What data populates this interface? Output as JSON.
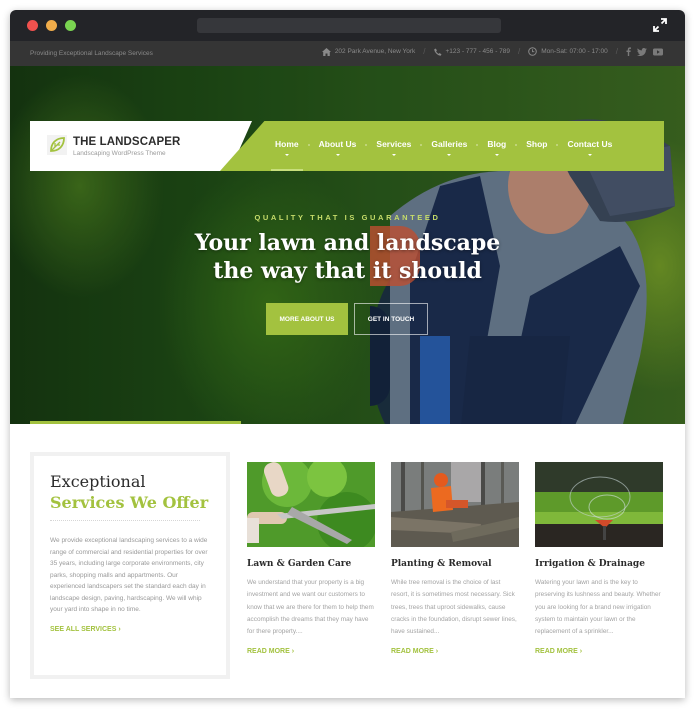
{
  "browser": {
    "window_controls": [
      "close",
      "minimize",
      "maximize"
    ],
    "expand_icon": "expand-arrows-icon"
  },
  "topbar": {
    "tagline": "Providing Exceptional Landscape Services",
    "address": "202 Park Avenue, New York",
    "phone": "+123 - 777 - 456 - 789",
    "hours": "Mon-Sat: 07:00 - 17:00",
    "separator": "/",
    "social": [
      "facebook-icon",
      "twitter-icon",
      "youtube-icon"
    ]
  },
  "header": {
    "logo_title": "THE LANDSCAPER",
    "logo_subtitle": "Landscaping WordPress Theme",
    "nav": [
      {
        "label": "Home",
        "active": true
      },
      {
        "label": "About Us"
      },
      {
        "label": "Services"
      },
      {
        "label": "Galleries"
      },
      {
        "label": "Blog"
      },
      {
        "label": "Shop"
      },
      {
        "label": "Contact Us"
      }
    ]
  },
  "hero": {
    "kicker": "QUALITY THAT IS GUARANTEED",
    "title_line1": "Your lawn and landscape",
    "title_line2": "the way that it should",
    "primary_button": "MORE ABOUT US",
    "secondary_button": "GET IN TOUCH"
  },
  "intro": {
    "heading_line1": "Exceptional",
    "heading_line2": "Services We Offer",
    "text": "We provide exceptional landscaping services to a wide range of commercial and residential properties for over 35 years, including large corporate environments, city parks, shopping malls and appartments. Our experienced landscapers set the standard each day in landscape design, paving, hardscaping. We will whip your yard into shape in no time.",
    "link": "SEE ALL SERVICES ›"
  },
  "services": [
    {
      "title": "Lawn & Garden Care",
      "text": "We understand that your property is a big investment and we want our customers to know that we are there for them to help them accomplish the dreams that they may have for there property....",
      "link": "READ MORE ›"
    },
    {
      "title": "Planting & Removal",
      "text": "While tree removal is the choice of last resort, it is sometimes most necessary. Sick trees, trees that uproot sidewalks, cause cracks in the foundation, disrupt sewer lines, have sustained...",
      "link": "READ MORE ›"
    },
    {
      "title": "Irrigation & Drainage",
      "text": "Watering your lawn and is the key to preserving its lushness and beauty. Whether you are looking for a brand new irrigation system to maintain your lawn or the replacement of a sprinkler...",
      "link": "READ MORE ›"
    }
  ],
  "colors": {
    "accent": "#a3c23f",
    "topbar": "#353535",
    "titlebar": "#232428"
  }
}
